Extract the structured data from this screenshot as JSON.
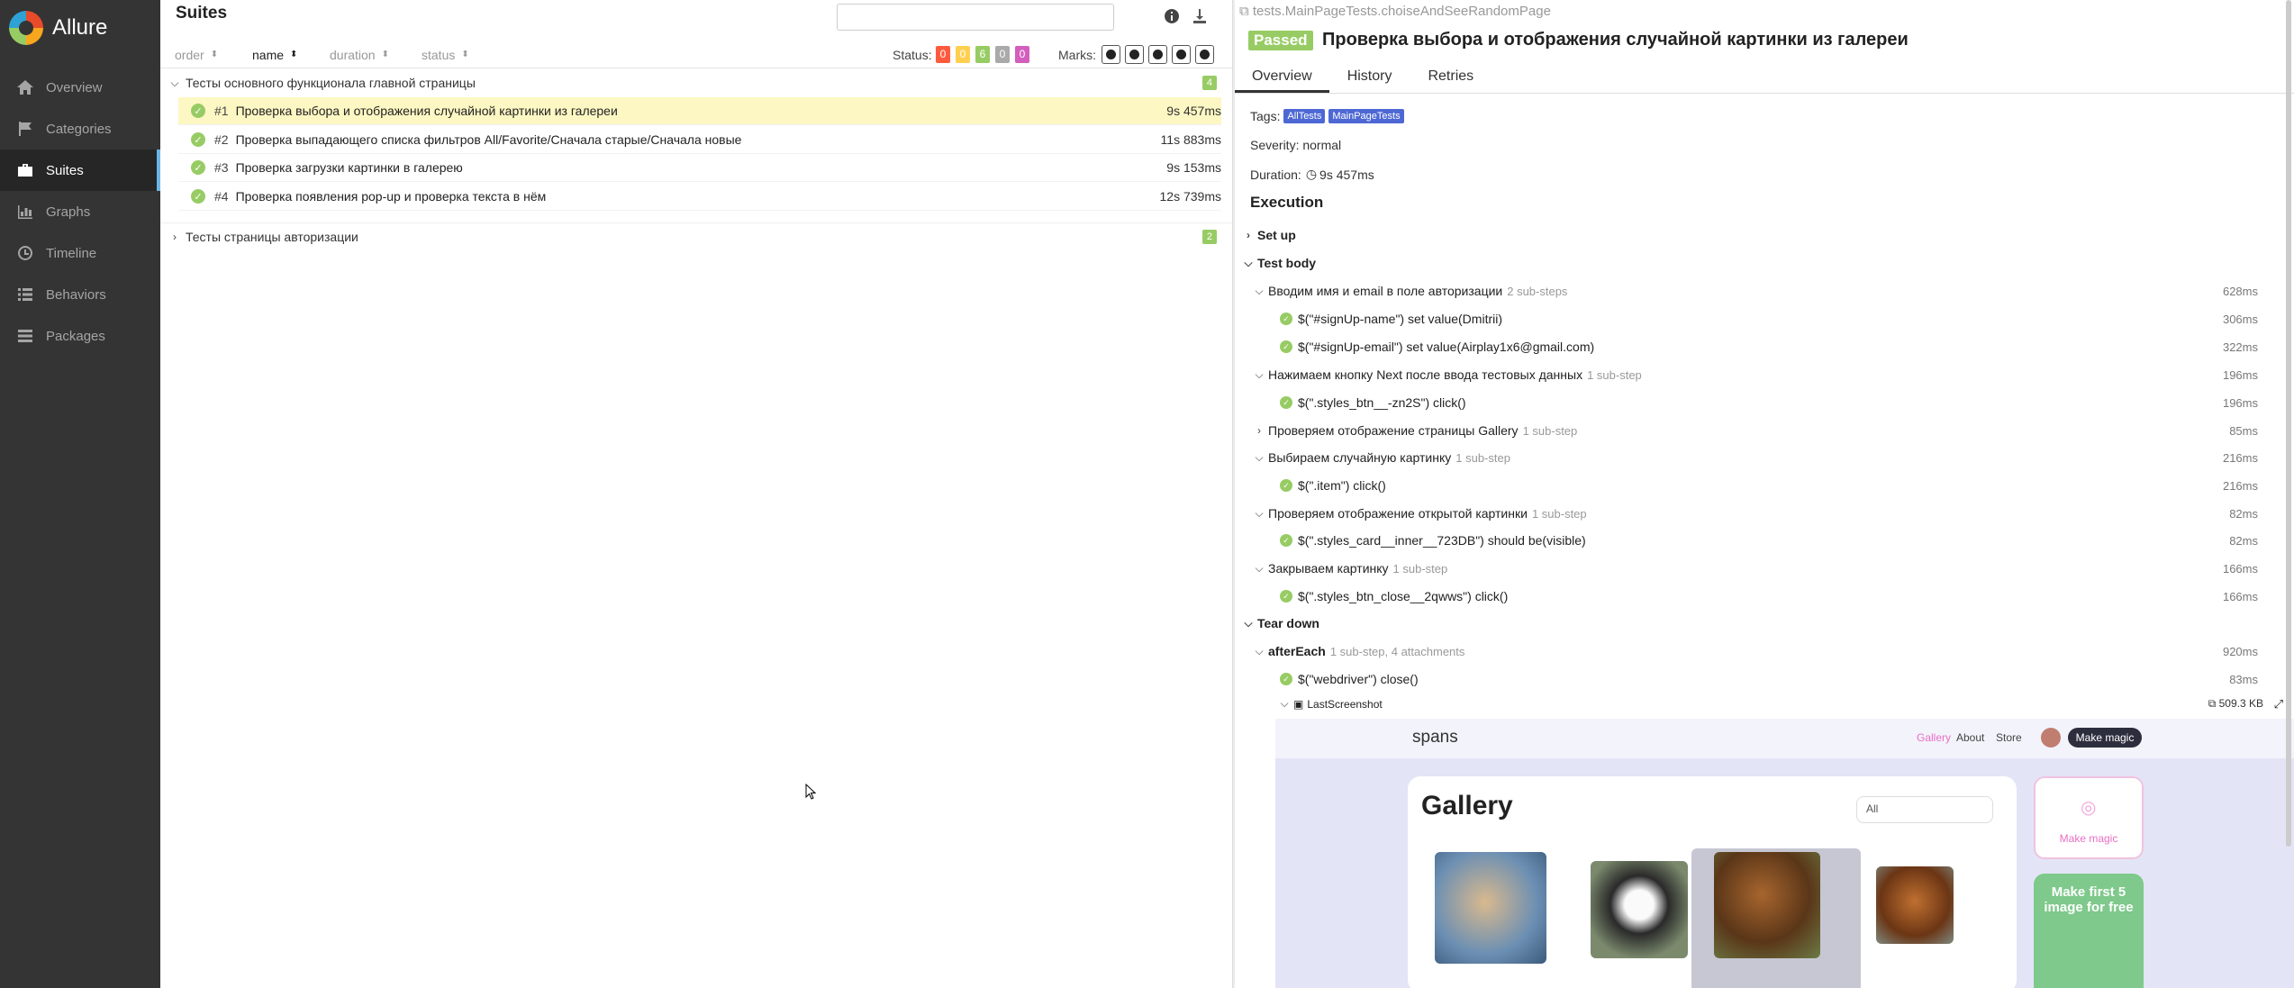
{
  "app": {
    "name": "Allure"
  },
  "sidebar": {
    "items": [
      {
        "label": "Overview",
        "icon": "home-icon"
      },
      {
        "label": "Categories",
        "icon": "flag-icon"
      },
      {
        "label": "Suites",
        "icon": "briefcase-icon",
        "active": true
      },
      {
        "label": "Graphs",
        "icon": "bar-chart-icon"
      },
      {
        "label": "Timeline",
        "icon": "clock-icon"
      },
      {
        "label": "Behaviors",
        "icon": "list-icon"
      },
      {
        "label": "Packages",
        "icon": "stack-icon"
      }
    ]
  },
  "suites": {
    "title": "Suites",
    "search_value": "",
    "sort": {
      "order": "order",
      "name": "name",
      "duration": "duration",
      "status": "status"
    },
    "status_label": "Status:",
    "status_counts": [
      {
        "value": "0",
        "color": "#fd5a3e"
      },
      {
        "value": "0",
        "color": "#ffd050"
      },
      {
        "value": "6",
        "color": "#97cc64"
      },
      {
        "value": "0",
        "color": "#aaaaaa"
      },
      {
        "value": "0",
        "color": "#d35ebe"
      }
    ],
    "marks_label": "Marks:",
    "groups": [
      {
        "name": "Тесты основного функционала главной страницы",
        "count": "4",
        "expanded": true
      },
      {
        "name": "Тесты страницы авторизации",
        "count": "2",
        "expanded": false
      }
    ],
    "tests": [
      {
        "num": "#1",
        "name": "Проверка выбора и отображения случайной картинки из галереи",
        "duration": "9s 457ms"
      },
      {
        "num": "#2",
        "name": "Проверка выпадающего списка фильтров All/Favorite/Сначала старые/Сначала новые",
        "duration": "11s 883ms"
      },
      {
        "num": "#3",
        "name": "Проверка загрузки картинки в галерею",
        "duration": "9s 153ms"
      },
      {
        "num": "#4",
        "name": "Проверка появления pop-up и проверка текста в нём",
        "duration": "12s 739ms"
      }
    ]
  },
  "detail": {
    "path": "tests.MainPageTests.choiseAndSeeRandomPage",
    "status": "Passed",
    "title": "Проверка выбора и отображения случайной картинки из галереи",
    "tabs": [
      "Overview",
      "History",
      "Retries"
    ],
    "tags_label": "Tags:",
    "tags": [
      "AllTests",
      "MainPageTests"
    ],
    "severity": "Severity: normal",
    "duration_label": "Duration:",
    "duration": "9s 457ms",
    "execution": "Execution",
    "setup": "Set up",
    "test_body": "Test body",
    "teardown": "Tear down",
    "steps": [
      {
        "name": "Вводим имя и email в поле авторизации",
        "sub": "2 sub-steps",
        "dur": "628ms"
      },
      {
        "name": "$(\"#signUp-name\") set value(Dmitrii)",
        "sub": "",
        "dur": "306ms"
      },
      {
        "name": "$(\"#signUp-email\") set value(Airplay1x6@gmail.com)",
        "sub": "",
        "dur": "322ms"
      },
      {
        "name": "Нажимаем кнопку Next после ввода тестовых данных",
        "sub": "1 sub-step",
        "dur": "196ms"
      },
      {
        "name": "$(\".styles_btn__-zn2S\") click()",
        "sub": "",
        "dur": "196ms"
      },
      {
        "name": "Проверяем отображение страницы Gallery",
        "sub": "1 sub-step",
        "dur": "85ms"
      },
      {
        "name": "Выбираем случайную картинку",
        "sub": "1 sub-step",
        "dur": "216ms"
      },
      {
        "name": "$(\".item\") click()",
        "sub": "",
        "dur": "216ms"
      },
      {
        "name": "Проверяем отображение открытой картинки",
        "sub": "1 sub-step",
        "dur": "82ms"
      },
      {
        "name": "$(\".styles_card__inner__723DB\") should be(visible)",
        "sub": "",
        "dur": "82ms"
      },
      {
        "name": "Закрываем картинку",
        "sub": "1 sub-step",
        "dur": "166ms"
      },
      {
        "name": "$(\".styles_btn_close__2qwws\") click()",
        "sub": "",
        "dur": "166ms"
      }
    ],
    "after_each": {
      "name": "afterEach",
      "sub": "1 sub-step, 4 attachments",
      "dur": "920ms"
    },
    "webdriver_close": {
      "name": "$(\"webdriver\") close()",
      "dur": "83ms"
    },
    "attachment": {
      "name": "LastScreenshot",
      "size": "509.3 KB"
    }
  },
  "screenshot": {
    "logo": "spans",
    "links": [
      "Gallery",
      "About",
      "Store"
    ],
    "magic_button": "Make magic",
    "gallery_title": "Gallery",
    "filter_value": "All",
    "side_card_text": "Make magic",
    "promo_text": "Make first 5 image for free"
  }
}
